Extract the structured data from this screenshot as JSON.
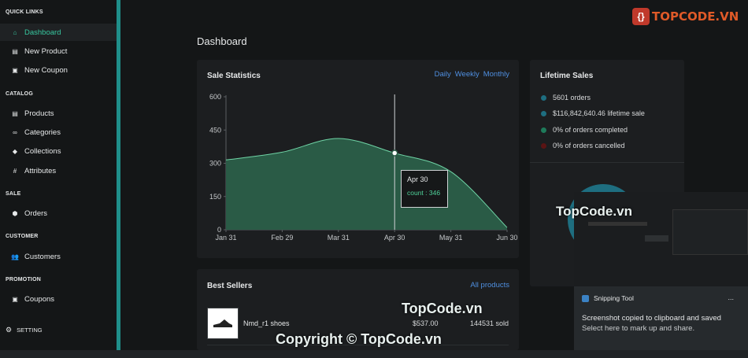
{
  "sidebar": {
    "sections": [
      {
        "title": "QUICK LINKS",
        "items": [
          {
            "label": "Dashboard",
            "icon": "home-icon",
            "active": true
          },
          {
            "label": "New Product",
            "icon": "box-icon"
          },
          {
            "label": "New Coupon",
            "icon": "gift-icon"
          }
        ]
      },
      {
        "title": "CATALOG",
        "items": [
          {
            "label": "Products",
            "icon": "box-icon"
          },
          {
            "label": "Categories",
            "icon": "link-icon"
          },
          {
            "label": "Collections",
            "icon": "tag-icon"
          },
          {
            "label": "Attributes",
            "icon": "hash-icon"
          }
        ]
      },
      {
        "title": "SALE",
        "items": [
          {
            "label": "Orders",
            "icon": "cube-icon"
          }
        ]
      },
      {
        "title": "CUSTOMER",
        "items": [
          {
            "label": "Customers",
            "icon": "users-icon"
          }
        ]
      },
      {
        "title": "PROMOTION",
        "items": [
          {
            "label": "Coupons",
            "icon": "gift-icon"
          }
        ]
      }
    ],
    "setting_label": "SETTING"
  },
  "page_title": "Dashboard",
  "sale_statistics": {
    "title": "Sale Statistics",
    "periods": [
      "Daily",
      "Weekly",
      "Monthly"
    ],
    "tooltip": {
      "date": "Apr 30",
      "label": "count : 346"
    }
  },
  "chart_data": {
    "type": "area",
    "x": [
      "Jan 31",
      "Feb 29",
      "Mar 31",
      "Apr 30",
      "May 31",
      "Jun 30"
    ],
    "values": [
      315,
      350,
      412,
      346,
      262,
      10
    ],
    "ylim": [
      0,
      600
    ],
    "yticks": [
      600,
      450,
      300,
      150,
      0
    ],
    "grid": false
  },
  "lifetime_sales": {
    "title": "Lifetime Sales",
    "items": [
      {
        "text": "5601 orders",
        "color": "#1e6e80"
      },
      {
        "text": "$116,842,640.46 lifetime sale",
        "color": "#1e6e80"
      },
      {
        "text": "0% of orders completed",
        "color": "#1e7a5a"
      },
      {
        "text": "0% of orders cancelled",
        "color": "#5a1414"
      }
    ]
  },
  "best_sellers": {
    "title": "Best Sellers",
    "all_link": "All products",
    "rows": [
      {
        "name": "Nmd_r1 shoes",
        "price": "$537.00",
        "sold": "144531 sold"
      }
    ]
  },
  "snipping": {
    "app": "Snipping Tool",
    "menu": "...",
    "message": "Screenshot copied to clipboard and saved",
    "hint": "Select here to mark up and share."
  },
  "watermarks": {
    "logo_text": "TOPCODE.VN",
    "mark1": "TopCode.vn",
    "mark2": "TopCode.vn",
    "copyright": "Copyright © TopCode.vn"
  }
}
